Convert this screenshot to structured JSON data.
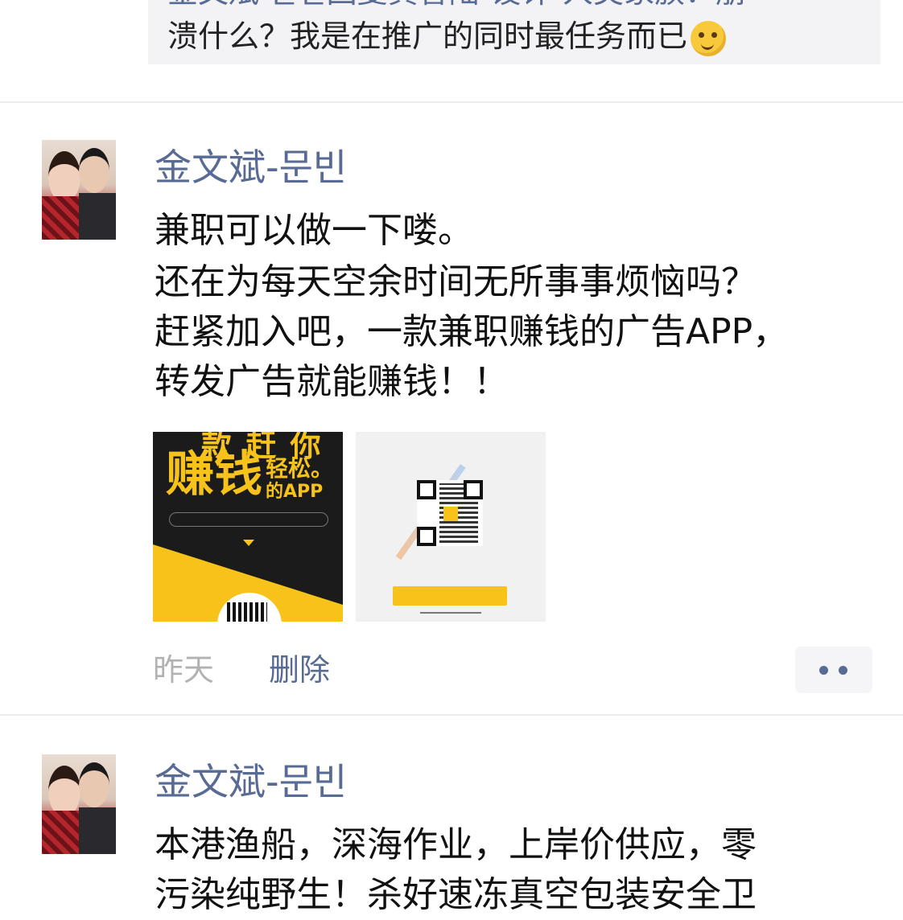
{
  "previous_comment": {
    "line1": "金文斌-문빈回复黄香陆-设计-人类家族：崩",
    "line2": "溃什么？我是在推广的同时最任务而已",
    "emoji": "smirk-face-emoji"
  },
  "posts": [
    {
      "author": "金文斌-문빈",
      "lines": [
        "兼职可以做一下喽。",
        "还在为每天空余时间无所事事烦恼吗？",
        "赶紧加入吧，一款兼职赚钱的广告APP，",
        "转发广告就能赚钱！！"
      ],
      "images": [
        {
          "top_text": "款 赶 你",
          "big_text": "赚钱",
          "side1": "轻松。",
          "side2": "的APP"
        },
        {
          "type": "qr-code-poster"
        }
      ],
      "time": "昨天",
      "delete_label": "删除"
    },
    {
      "author": "金文斌-문빈",
      "lines": [
        "本港渔船，深海作业，上岸价供应，零",
        "污染纯野生！杀好速冻真空包装安全卫"
      ]
    }
  ],
  "colors": {
    "link": "#576b95",
    "muted": "#b2b2b2",
    "accent": "#f7c31a"
  }
}
